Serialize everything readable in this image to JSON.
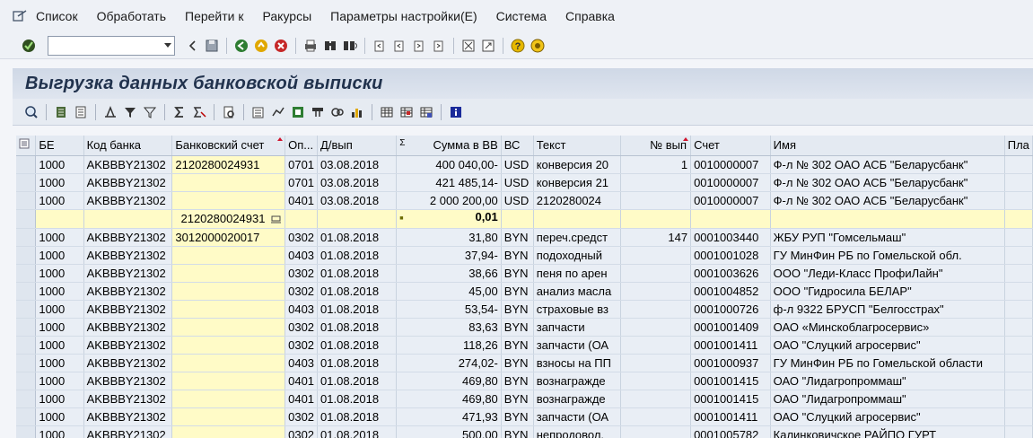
{
  "menubar": {
    "items": [
      "Список",
      "Обработать",
      "Перейти к",
      "Ракурсы",
      "Параметры настройки(E)",
      "Система",
      "Справка"
    ]
  },
  "toolbar": {
    "command_field_value": "",
    "icons": [
      "check-icon",
      "command-field",
      "back-arrow-icon",
      "save-icon",
      "back-icon",
      "exit-icon",
      "cancel-icon",
      "print-icon",
      "find-icon",
      "find-next-icon",
      "first-page-icon",
      "previous-page-icon",
      "next-page-icon",
      "last-page-icon",
      "create-session-icon",
      "shortcut-icon",
      "help-icon",
      "customize-layout-icon"
    ]
  },
  "title": "Выгрузка данных банковской выписки",
  "alv_toolbar": {
    "icons": [
      "details-icon",
      "sort-ascending-icon",
      "sort-descending-icon",
      "find-icon",
      "filter-icon",
      "set-filter-icon",
      "sum-icon",
      "subtotal-icon",
      "print-preview-icon",
      "export-icon",
      "send-icon",
      "spreadsheet-icon",
      "abc-analysis-icon",
      "graphic-icon",
      "change-layout-icon",
      "select-layout-icon",
      "save-layout-icon",
      "information-icon"
    ]
  },
  "grid": {
    "columns": [
      {
        "key": "be",
        "label": "БЕ"
      },
      {
        "key": "bank",
        "label": "Код банка"
      },
      {
        "key": "account",
        "label": "Банковский счет"
      },
      {
        "key": "op",
        "label": "Оп..."
      },
      {
        "key": "date",
        "label": "Д/вып"
      },
      {
        "key": "sum",
        "label": "Сумма в ВВ"
      },
      {
        "key": "cur",
        "label": "ВС"
      },
      {
        "key": "text",
        "label": "Текст"
      },
      {
        "key": "num",
        "label": "№ вып"
      },
      {
        "key": "acct",
        "label": "Счет"
      },
      {
        "key": "name",
        "label": "Имя"
      },
      {
        "key": "pay",
        "label": "Пла"
      }
    ],
    "sum_marker": "Σ",
    "rows": [
      {
        "be": "1000",
        "bank": "AKBBBY21302",
        "account": "2120280024931",
        "op": "0701",
        "date": "03.08.2018",
        "sum": "400 040,00-",
        "cur": "USD",
        "text": "конверсия 20",
        "num": "1",
        "acct": "0010000007",
        "name": "Ф-л № 302 ОАО АСБ \"Беларусбанк\"",
        "pay": ""
      },
      {
        "be": "1000",
        "bank": "AKBBBY21302",
        "account": "",
        "op": "0701",
        "date": "03.08.2018",
        "sum": "421 485,14-",
        "cur": "USD",
        "text": "конверсия 21",
        "num": "",
        "acct": "0010000007",
        "name": "Ф-л № 302 ОАО АСБ \"Беларусбанк\"",
        "pay": ""
      },
      {
        "be": "1000",
        "bank": "AKBBBY21302",
        "account": "",
        "op": "0401",
        "date": "03.08.2018",
        "sum": "2 000 200,00",
        "cur": "USD",
        "text": "2120280024",
        "num": "",
        "acct": "0010000007",
        "name": "Ф-л № 302 ОАО АСБ \"Беларусбанк\"",
        "pay": ""
      },
      {
        "subtotal": true,
        "account": "2120280024931",
        "sum_marker": "■",
        "sum": "0,01"
      },
      {
        "be": "1000",
        "bank": "AKBBBY21302",
        "account": "3012000020017",
        "op": "0302",
        "date": "01.08.2018",
        "sum": "31,80",
        "cur": "BYN",
        "text": "переч.средст",
        "num": "147",
        "acct": "0001003440",
        "name": "ЖБУ РУП \"Гомсельмаш\"",
        "pay": ""
      },
      {
        "be": "1000",
        "bank": "AKBBBY21302",
        "account": "",
        "op": "0403",
        "date": "01.08.2018",
        "sum": "37,94-",
        "cur": "BYN",
        "text": "подоходный",
        "num": "",
        "acct": "0001001028",
        "name": "ГУ МинФин РБ по Гомельской обл.",
        "pay": ""
      },
      {
        "be": "1000",
        "bank": "AKBBBY21302",
        "account": "",
        "op": "0302",
        "date": "01.08.2018",
        "sum": "38,66",
        "cur": "BYN",
        "text": "пеня по арен",
        "num": "",
        "acct": "0001003626",
        "name": "ООО \"Леди-Класс ПрофиЛайн\"",
        "pay": ""
      },
      {
        "be": "1000",
        "bank": "AKBBBY21302",
        "account": "",
        "op": "0302",
        "date": "01.08.2018",
        "sum": "45,00",
        "cur": "BYN",
        "text": "анализ масла",
        "num": "",
        "acct": "0001004852",
        "name": "ООО \"Гидросила БЕЛАР\"",
        "pay": ""
      },
      {
        "be": "1000",
        "bank": "AKBBBY21302",
        "account": "",
        "op": "0403",
        "date": "01.08.2018",
        "sum": "53,54-",
        "cur": "BYN",
        "text": "страховые вз",
        "num": "",
        "acct": "0001000726",
        "name": "ф-л 9322 БРУСП \"Белгосстрах\"",
        "pay": ""
      },
      {
        "be": "1000",
        "bank": "AKBBBY21302",
        "account": "",
        "op": "0302",
        "date": "01.08.2018",
        "sum": "83,63",
        "cur": "BYN",
        "text": "запчасти",
        "num": "",
        "acct": "0001001409",
        "name": "ОАО «Минскоблагросервис»",
        "pay": ""
      },
      {
        "be": "1000",
        "bank": "AKBBBY21302",
        "account": "",
        "op": "0302",
        "date": "01.08.2018",
        "sum": "118,26",
        "cur": "BYN",
        "text": "запчасти (ОА",
        "num": "",
        "acct": "0001001411",
        "name": "ОАО \"Слуцкий агросервис\"",
        "pay": ""
      },
      {
        "be": "1000",
        "bank": "AKBBBY21302",
        "account": "",
        "op": "0403",
        "date": "01.08.2018",
        "sum": "274,02-",
        "cur": "BYN",
        "text": "взносы на ПП",
        "num": "",
        "acct": "0001000937",
        "name": "ГУ МинФин РБ  по Гомельской области",
        "pay": ""
      },
      {
        "be": "1000",
        "bank": "AKBBBY21302",
        "account": "",
        "op": "0401",
        "date": "01.08.2018",
        "sum": "469,80",
        "cur": "BYN",
        "text": "вознагражде",
        "num": "",
        "acct": "0001001415",
        "name": "ОАО \"Лидагропроммаш\"",
        "pay": ""
      },
      {
        "be": "1000",
        "bank": "AKBBBY21302",
        "account": "",
        "op": "0401",
        "date": "01.08.2018",
        "sum": "469,80",
        "cur": "BYN",
        "text": "вознагражде",
        "num": "",
        "acct": "0001001415",
        "name": "ОАО \"Лидагропроммаш\"",
        "pay": ""
      },
      {
        "be": "1000",
        "bank": "AKBBBY21302",
        "account": "",
        "op": "0302",
        "date": "01.08.2018",
        "sum": "471,93",
        "cur": "BYN",
        "text": "запчасти (ОА",
        "num": "",
        "acct": "0001001411",
        "name": "ОАО \"Слуцкий агросервис\"",
        "pay": ""
      },
      {
        "be": "1000",
        "bank": "AKBBBY21302",
        "account": "",
        "op": "0302",
        "date": "01.08.2018",
        "sum": "500,00",
        "cur": "BYN",
        "text": "непродовол.",
        "num": "",
        "acct": "0001005782",
        "name": "Калинковичское РАЙПО ГУРТ",
        "pay": ""
      }
    ]
  }
}
